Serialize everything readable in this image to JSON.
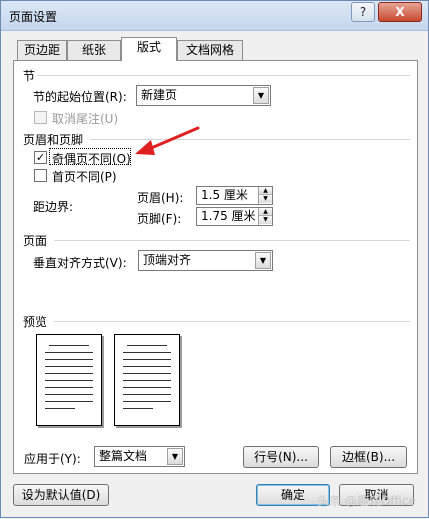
{
  "window": {
    "title": "页面设置",
    "help_label": "?",
    "close_label": "X"
  },
  "tabs": [
    {
      "label": "页边距"
    },
    {
      "label": "纸张"
    },
    {
      "label": "版式"
    },
    {
      "label": "文档网格"
    }
  ],
  "section": {
    "title": "节",
    "start_label": "节的起始位置(R):",
    "start_value": "新建页",
    "suppress_endnotes_label": "取消尾注(U)"
  },
  "header_footer": {
    "title": "页眉和页脚",
    "odd_even_label": "奇偶页不同(O)",
    "first_page_label": "首页不同(P)",
    "distance_label": "距边界:",
    "header_label": "页眉(H):",
    "header_value": "1.5 厘米",
    "footer_label": "页脚(F):",
    "footer_value": "1.75 厘米"
  },
  "page": {
    "title": "页面",
    "valign_label": "垂直对齐方式(V):",
    "valign_value": "顶端对齐"
  },
  "preview": {
    "title": "预览"
  },
  "apply": {
    "label": "应用于(Y):",
    "value": "整篇文档",
    "line_numbers_label": "行号(N)...",
    "borders_label": "边框(B)..."
  },
  "footer": {
    "default_label": "设为默认值(D)",
    "ok_label": "确定",
    "cancel_label": "取消",
    "watermark": "头条 @趣观Office"
  },
  "colors": {
    "annotation_arrow": "#e02020"
  }
}
